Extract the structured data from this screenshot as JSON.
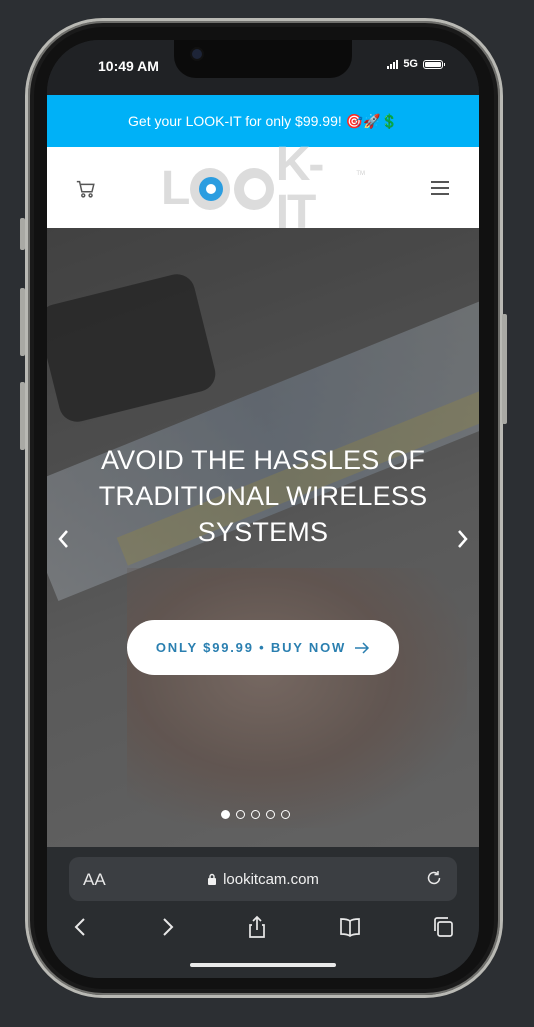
{
  "status_bar": {
    "time": "10:49 AM",
    "network": "5G"
  },
  "promo_bar": {
    "text": "Get your LOOK-IT for only $99.99! 🎯🚀💲",
    "background": "#00b1f7"
  },
  "header": {
    "logo_left": "L",
    "logo_right": "K-IT",
    "logo_tm": "TM",
    "cart_icon": "cart-icon",
    "menu_icon": "hamburger-menu-icon"
  },
  "hero": {
    "title": "AVOID THE HASSLES OF TRADITIONAL WIRELESS SYSTEMS",
    "cta_label": "ONLY $99.99 • BUY NOW",
    "cta_color": "#2a7fb0",
    "slides_total": 5,
    "active_slide": 1
  },
  "browser": {
    "text_size_label": "AA",
    "url": "lookitcam.com",
    "toolbar_icons": [
      "back-icon",
      "forward-icon",
      "share-icon",
      "bookmarks-icon",
      "tabs-icon"
    ]
  }
}
